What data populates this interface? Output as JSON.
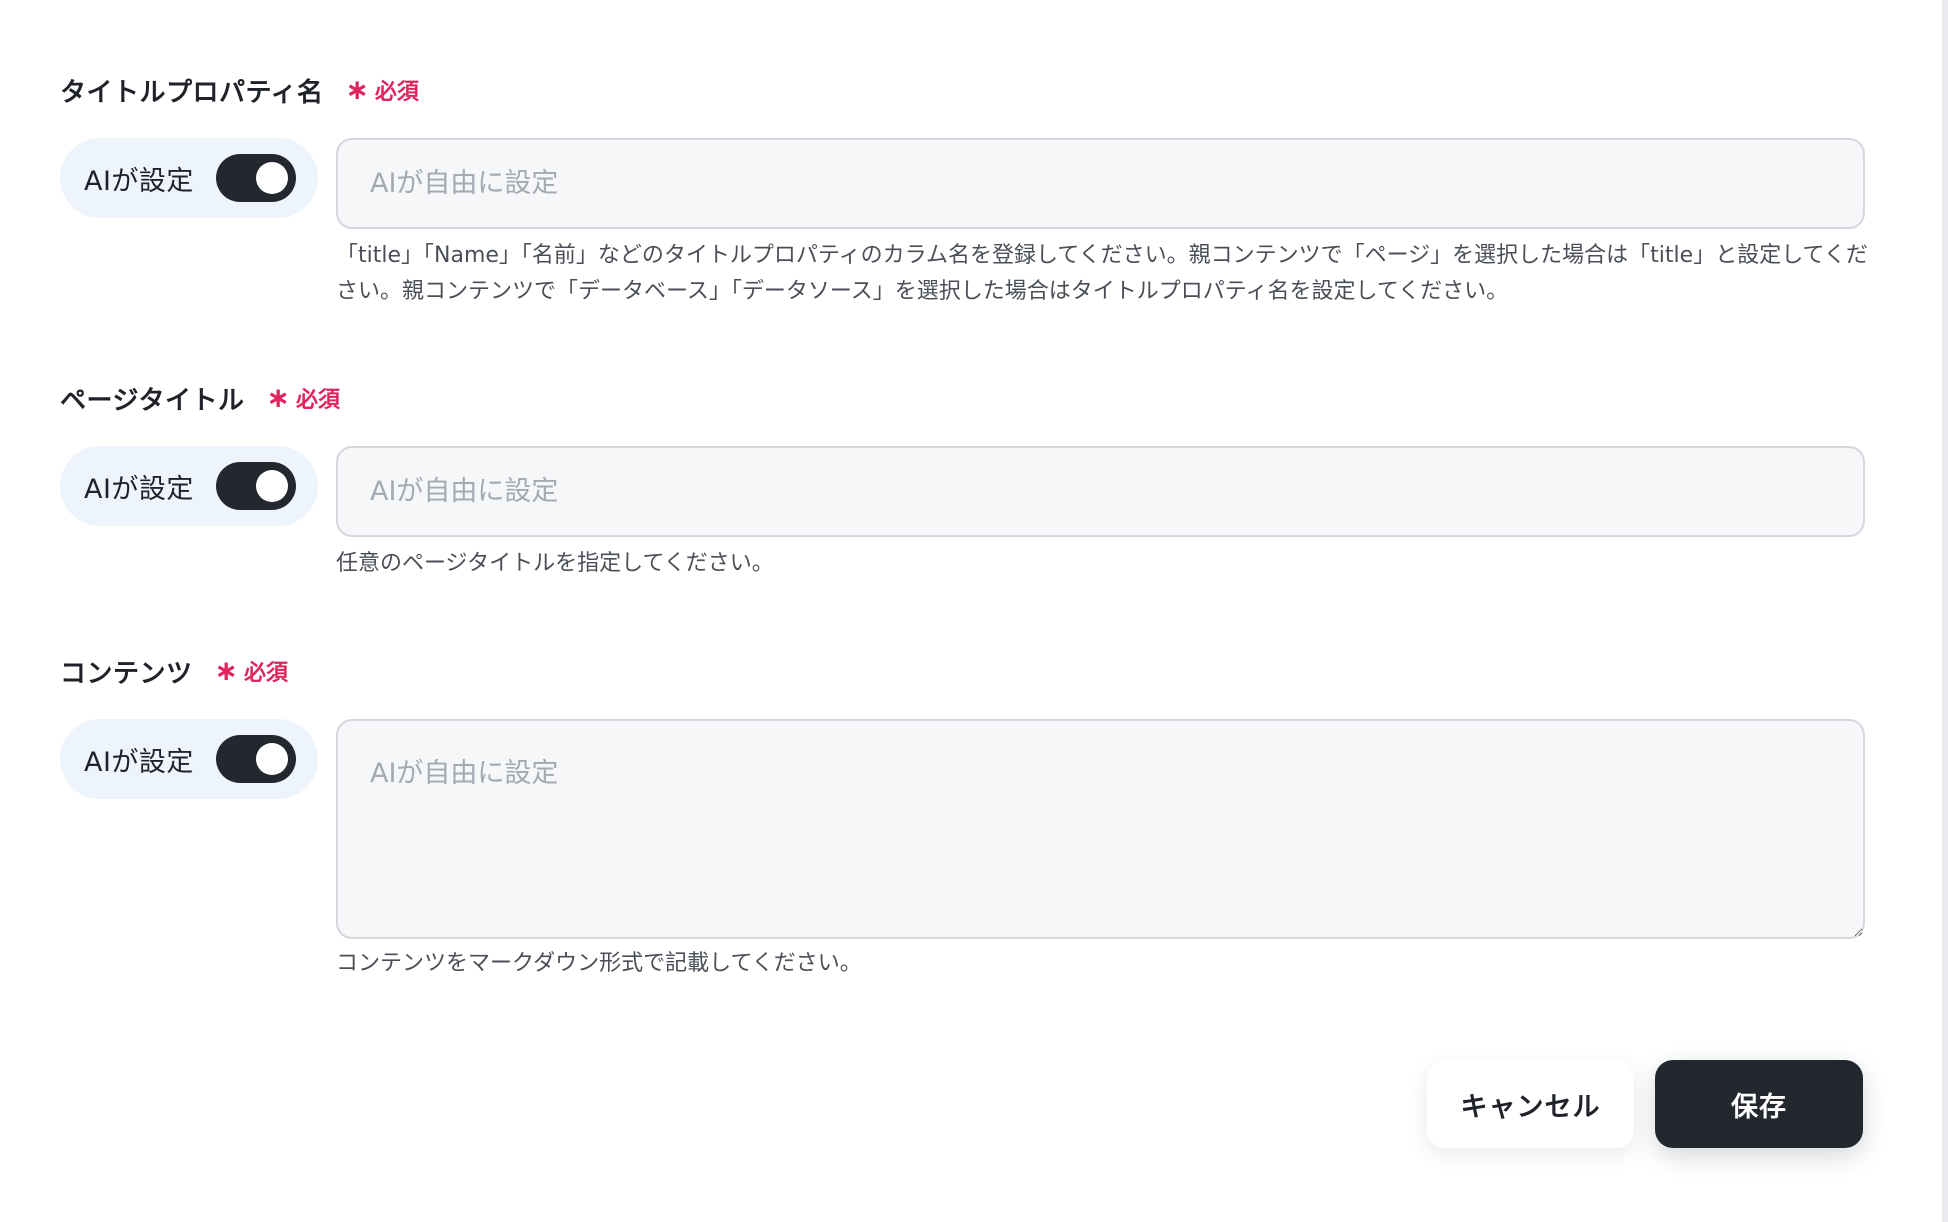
{
  "required_label": "必須",
  "ai_setting_label": "AIが設定",
  "fields": [
    {
      "label": "タイトルプロパティ名",
      "required": true,
      "ai_enabled": true,
      "value": "",
      "placeholder": "AIが自由に設定",
      "help_line1": "「title」「Name」「名前」などのタイトルプロパティのカラム名を登録してください。親コンテンツで「ページ」を選択した場合は「title」と設定してくだ",
      "help_line2": "さい。親コンテンツで「データベース」「データソース」を選択した場合はタイトルプロパティ名を設定してください。"
    },
    {
      "label": "ページタイトル",
      "required": true,
      "ai_enabled": true,
      "value": "",
      "placeholder": "AIが自由に設定",
      "help": "任意のページタイトルを指定してください。"
    },
    {
      "label": "コンテンツ",
      "required": true,
      "ai_enabled": true,
      "value": "",
      "placeholder": "AIが自由に設定",
      "help": "コンテンツをマークダウン形式で記載してください。"
    }
  ],
  "buttons": {
    "cancel": "キャンセル",
    "save": "保存"
  }
}
